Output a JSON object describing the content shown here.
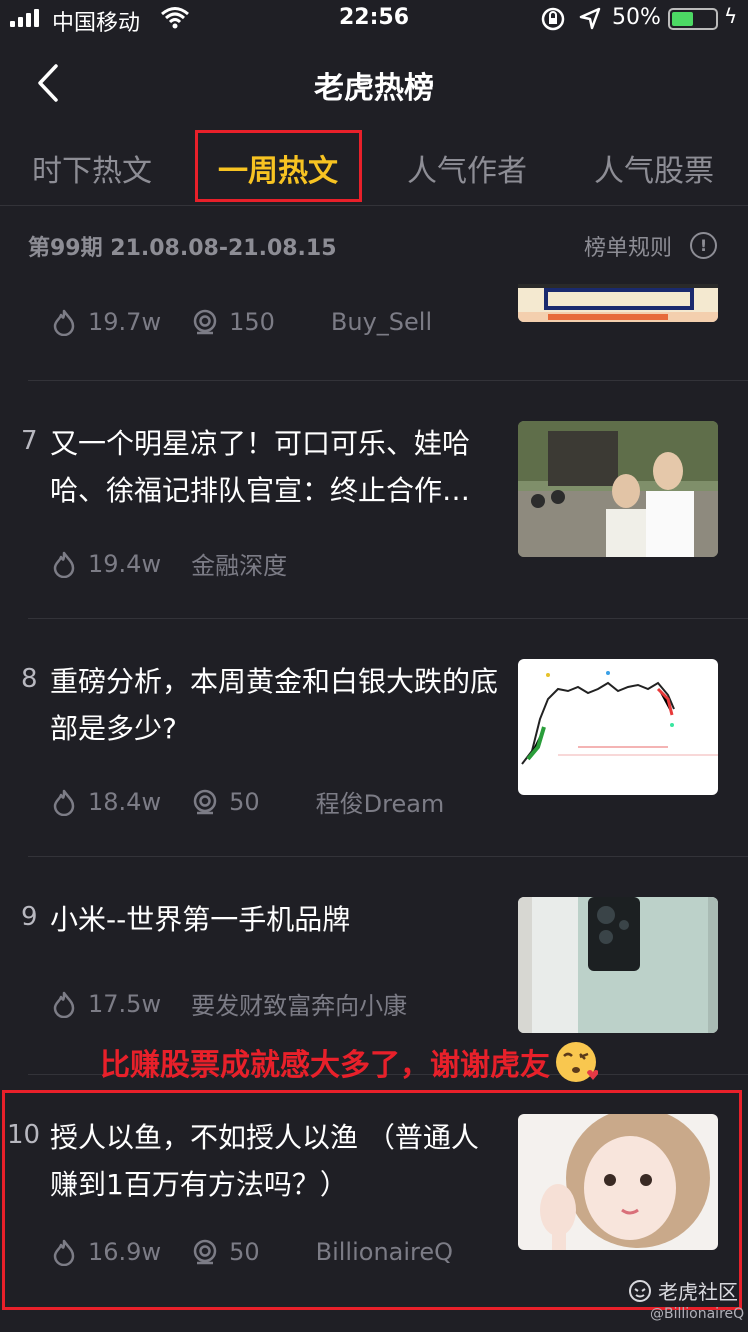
{
  "status_bar": {
    "carrier": "中国移动",
    "time": "22:56",
    "battery_pct": "50%",
    "battery_level": 0.5
  },
  "header": {
    "title": "老虎热榜"
  },
  "tabs": [
    {
      "label": "时下热文",
      "active": false
    },
    {
      "label": "一周热文",
      "active": true
    },
    {
      "label": "人气作者",
      "active": false
    },
    {
      "label": "人气股票",
      "active": false
    }
  ],
  "period": {
    "label": "第99期 21.08.08-21.08.15",
    "rules_label": "榜单规则",
    "rules_icon": "!"
  },
  "items": [
    {
      "rank": "",
      "title": "",
      "heat": "19.7w",
      "comments": "150",
      "author": "Buy_Sell",
      "thumb_icon": "chinese-text-banner"
    },
    {
      "rank": "7",
      "title": "又一个明星凉了！可口可乐、娃哈哈、徐福记排队官宣：终止合作…",
      "heat": "19.4w",
      "comments": "",
      "author": "金融深度",
      "thumb_icon": "people-photo"
    },
    {
      "rank": "8",
      "title": "重磅分析，本周黄金和白银大跌的底部是多少?",
      "heat": "18.4w",
      "comments": "50",
      "author": "程俊Dream",
      "thumb_icon": "candlestick-chart"
    },
    {
      "rank": "9",
      "title": "小米--世界第一手机品牌",
      "heat": "17.5w",
      "comments": "",
      "author": "要发财致富奔向小康",
      "thumb_icon": "phone-photo"
    },
    {
      "rank": "10",
      "title": "授人以鱼，不如授人以渔 （普通人赚到1百万有方法吗？）",
      "heat": "16.9w",
      "comments": "50",
      "author": "BillionaireQ",
      "thumb_icon": "portrait-photo"
    }
  ],
  "annotation": {
    "text": "比赚股票成就感大多了，谢谢虎友",
    "emoji": "kissing-face"
  },
  "watermark": {
    "text": "老虎社区",
    "credit": "@BillionaireQ"
  },
  "colors": {
    "background": "#1f1f25",
    "accent": "#f7c322",
    "highlight": "#e8202a",
    "muted": "#8d8d95"
  }
}
